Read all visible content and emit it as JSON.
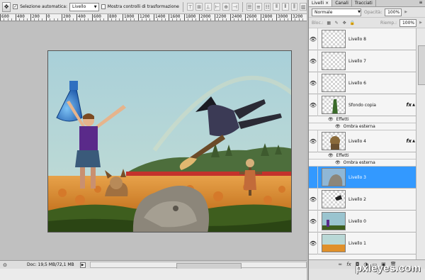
{
  "options_bar": {
    "auto_select_label": "Selezione automatica:",
    "auto_select_checked": true,
    "auto_select_target": "Livello",
    "transform_controls_label": "Mostra controlli di trasformazione",
    "transform_controls_checked": false
  },
  "ruler": {
    "labels": [
      "600",
      "400",
      "200",
      "0",
      "200",
      "400",
      "600",
      "800",
      "1000",
      "1200",
      "1400",
      "1600",
      "1800",
      "2000",
      "2200",
      "2400",
      "2600",
      "2800",
      "3000",
      "3200"
    ]
  },
  "status": {
    "doc_info": "Doc: 19,5 MB/72,1 MB"
  },
  "panel": {
    "tabs": [
      "Livelli",
      "Canali",
      "Tracciati"
    ],
    "blend_mode": "Normale",
    "opacity_label": "Opacità:",
    "opacity_value": "100%",
    "lock_label": "Bloc.:",
    "fill_label": "Riemp.:",
    "fill_value": "100%"
  },
  "layers": [
    {
      "name": "Livello 8",
      "visible": true,
      "selected": false,
      "fx": false
    },
    {
      "name": "Livello 7",
      "visible": true,
      "selected": false,
      "fx": false
    },
    {
      "name": "Livello 6",
      "visible": true,
      "selected": false,
      "fx": false
    },
    {
      "name": "Sfondo copia",
      "visible": true,
      "selected": false,
      "fx": true,
      "effects_label": "Effetti",
      "effect": "Ombra esterna"
    },
    {
      "name": "Livello 4",
      "visible": true,
      "selected": false,
      "fx": true,
      "effects_label": "Effetti",
      "effect": "Ombra esterna"
    },
    {
      "name": "Livello 3",
      "visible": false,
      "selected": true,
      "fx": false
    },
    {
      "name": "Livello 2",
      "visible": true,
      "selected": false,
      "fx": false
    },
    {
      "name": "Livello 0",
      "visible": true,
      "selected": false,
      "fx": false
    },
    {
      "name": "Livello 1",
      "visible": true,
      "selected": false,
      "fx": false
    }
  ],
  "fx_label": "fx",
  "watermark": "pxleyes.com",
  "colors": {
    "selected_layer": "#3399ff",
    "sky": "#9ac4cf",
    "field": "#e0902a",
    "grass": "#3e5e1e"
  }
}
